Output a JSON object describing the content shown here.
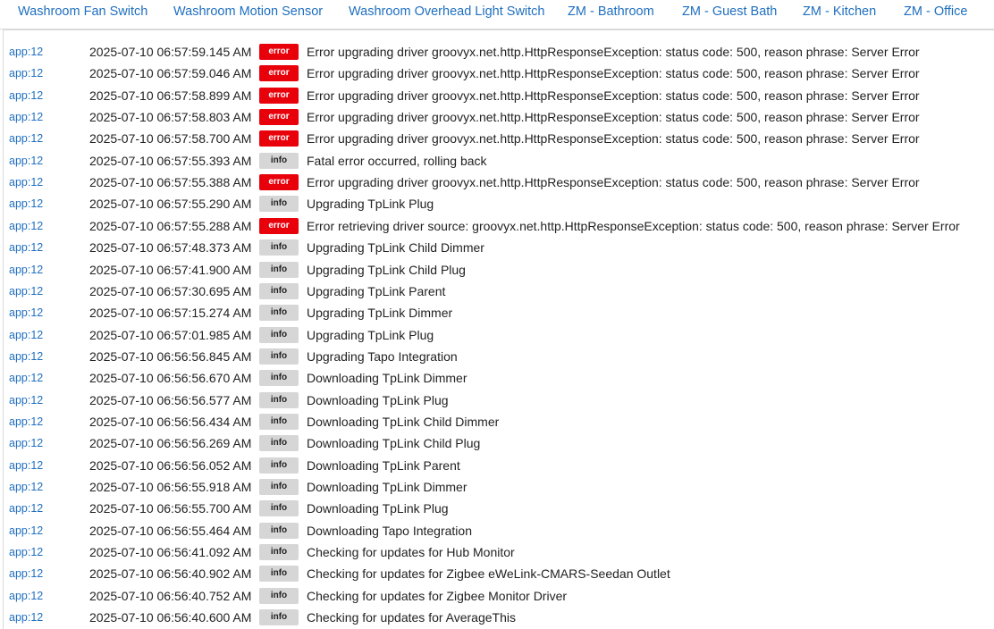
{
  "tabs": [
    "Washroom Fan Switch",
    "Washroom Motion Sensor",
    "Washroom Overhead Light Switch",
    "ZM - Bathroom",
    "ZM - Guest Bath",
    "ZM - Kitchen",
    "ZM - Office"
  ],
  "logs": [
    {
      "source": "app:12",
      "time": "2025-07-10 06:57:59.145 AM",
      "level": "error",
      "message": "Error upgrading driver groovyx.net.http.HttpResponseException: status code: 500, reason phrase: Server Error"
    },
    {
      "source": "app:12",
      "time": "2025-07-10 06:57:59.046 AM",
      "level": "error",
      "message": "Error upgrading driver groovyx.net.http.HttpResponseException: status code: 500, reason phrase: Server Error"
    },
    {
      "source": "app:12",
      "time": "2025-07-10 06:57:58.899 AM",
      "level": "error",
      "message": "Error upgrading driver groovyx.net.http.HttpResponseException: status code: 500, reason phrase: Server Error"
    },
    {
      "source": "app:12",
      "time": "2025-07-10 06:57:58.803 AM",
      "level": "error",
      "message": "Error upgrading driver groovyx.net.http.HttpResponseException: status code: 500, reason phrase: Server Error"
    },
    {
      "source": "app:12",
      "time": "2025-07-10 06:57:58.700 AM",
      "level": "error",
      "message": "Error upgrading driver groovyx.net.http.HttpResponseException: status code: 500, reason phrase: Server Error"
    },
    {
      "source": "app:12",
      "time": "2025-07-10 06:57:55.393 AM",
      "level": "info",
      "message": "Fatal error occurred, rolling back"
    },
    {
      "source": "app:12",
      "time": "2025-07-10 06:57:55.388 AM",
      "level": "error",
      "message": "Error upgrading driver groovyx.net.http.HttpResponseException: status code: 500, reason phrase: Server Error"
    },
    {
      "source": "app:12",
      "time": "2025-07-10 06:57:55.290 AM",
      "level": "info",
      "message": "Upgrading TpLink Plug"
    },
    {
      "source": "app:12",
      "time": "2025-07-10 06:57:55.288 AM",
      "level": "error",
      "message": "Error retrieving driver source: groovyx.net.http.HttpResponseException: status code: 500, reason phrase: Server Error"
    },
    {
      "source": "app:12",
      "time": "2025-07-10 06:57:48.373 AM",
      "level": "info",
      "message": "Upgrading TpLink Child Dimmer"
    },
    {
      "source": "app:12",
      "time": "2025-07-10 06:57:41.900 AM",
      "level": "info",
      "message": "Upgrading TpLink Child Plug"
    },
    {
      "source": "app:12",
      "time": "2025-07-10 06:57:30.695 AM",
      "level": "info",
      "message": "Upgrading TpLink Parent"
    },
    {
      "source": "app:12",
      "time": "2025-07-10 06:57:15.274 AM",
      "level": "info",
      "message": "Upgrading TpLink Dimmer"
    },
    {
      "source": "app:12",
      "time": "2025-07-10 06:57:01.985 AM",
      "level": "info",
      "message": "Upgrading TpLink Plug"
    },
    {
      "source": "app:12",
      "time": "2025-07-10 06:56:56.845 AM",
      "level": "info",
      "message": "Upgrading Tapo Integration"
    },
    {
      "source": "app:12",
      "time": "2025-07-10 06:56:56.670 AM",
      "level": "info",
      "message": "Downloading TpLink Dimmer"
    },
    {
      "source": "app:12",
      "time": "2025-07-10 06:56:56.577 AM",
      "level": "info",
      "message": "Downloading TpLink Plug"
    },
    {
      "source": "app:12",
      "time": "2025-07-10 06:56:56.434 AM",
      "level": "info",
      "message": "Downloading TpLink Child Dimmer"
    },
    {
      "source": "app:12",
      "time": "2025-07-10 06:56:56.269 AM",
      "level": "info",
      "message": "Downloading TpLink Child Plug"
    },
    {
      "source": "app:12",
      "time": "2025-07-10 06:56:56.052 AM",
      "level": "info",
      "message": "Downloading TpLink Parent"
    },
    {
      "source": "app:12",
      "time": "2025-07-10 06:56:55.918 AM",
      "level": "info",
      "message": "Downloading TpLink Dimmer"
    },
    {
      "source": "app:12",
      "time": "2025-07-10 06:56:55.700 AM",
      "level": "info",
      "message": "Downloading TpLink Plug"
    },
    {
      "source": "app:12",
      "time": "2025-07-10 06:56:55.464 AM",
      "level": "info",
      "message": "Downloading Tapo Integration"
    },
    {
      "source": "app:12",
      "time": "2025-07-10 06:56:41.092 AM",
      "level": "info",
      "message": "Checking for updates for Hub Monitor"
    },
    {
      "source": "app:12",
      "time": "2025-07-10 06:56:40.902 AM",
      "level": "info",
      "message": "Checking for updates for Zigbee eWeLink-CMARS-Seedan Outlet"
    },
    {
      "source": "app:12",
      "time": "2025-07-10 06:56:40.752 AM",
      "level": "info",
      "message": "Checking for updates for Zigbee Monitor Driver"
    },
    {
      "source": "app:12",
      "time": "2025-07-10 06:56:40.600 AM",
      "level": "info",
      "message": "Checking for updates for AverageThis"
    }
  ]
}
